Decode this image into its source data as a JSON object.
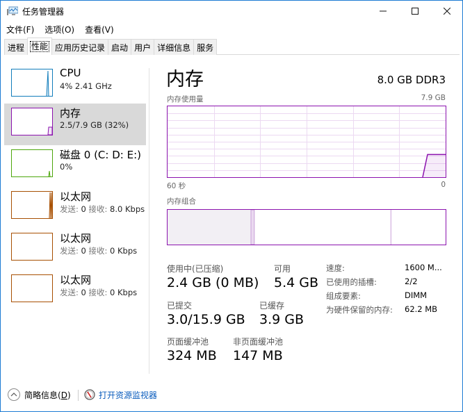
{
  "window": {
    "title": "任务管理器",
    "controls": {
      "minimize": "—",
      "maximize": "☐",
      "close": "✕"
    }
  },
  "menu": [
    "文件(F)",
    "选项(O)",
    "查看(V)"
  ],
  "tabs": [
    {
      "label": "进程",
      "active": false
    },
    {
      "label": "性能",
      "active": true
    },
    {
      "label": "应用历史记录",
      "active": false
    },
    {
      "label": "启动",
      "active": false
    },
    {
      "label": "用户",
      "active": false
    },
    {
      "label": "详细信息",
      "active": false
    },
    {
      "label": "服务",
      "active": false
    }
  ],
  "sidebar": {
    "items": [
      {
        "title": "CPU",
        "subtitle": "4% 2.41 GHz",
        "color": "#117dbb",
        "selected": false
      },
      {
        "title": "内存",
        "subtitle": "2.5/7.9 GB (32%)",
        "color": "#8b12ae",
        "selected": true
      },
      {
        "title": "磁盘 0 (C: D: E:)",
        "subtitle": "0%",
        "color": "#4da60c",
        "selected": false
      },
      {
        "title": "以太网",
        "send_label": "发送:",
        "send": "0",
        "recv_label": "接收:",
        "recv": "8.0 Kbps",
        "color": "#a74f01",
        "selected": false
      },
      {
        "title": "以太网",
        "send_label": "发送:",
        "send": "0",
        "recv_label": "接收:",
        "recv": "0 Kbps",
        "color": "#a74f01",
        "selected": false
      },
      {
        "title": "以太网",
        "send_label": "发送:",
        "send": "0",
        "recv_label": "接收:",
        "recv": "0 Kbps",
        "color": "#a74f01",
        "selected": false
      }
    ]
  },
  "main": {
    "title": "内存",
    "spec": "8.0 GB DDR3",
    "usage_graph": {
      "label": "内存使用量",
      "max_label": "7.9 GB",
      "x_left": "60 秒",
      "x_right": "0",
      "usage_fraction": 0.32,
      "color": "#8b12ae"
    },
    "composition": {
      "label": "内存组合",
      "in_use_fraction": 0.3,
      "modified_fraction": 0.012,
      "standby_fraction": 0.49
    },
    "stats": {
      "in_use_label": "使用中(已压缩)",
      "in_use_value": "2.4 GB (0 MB)",
      "available_label": "可用",
      "available_value": "5.4 GB",
      "committed_label": "已提交",
      "committed_value": "3.0/15.9 GB",
      "cached_label": "已缓存",
      "cached_value": "3.9 GB",
      "paged_label": "页面缓冲池",
      "paged_value": "324 MB",
      "nonpaged_label": "非页面缓冲池",
      "nonpaged_value": "147 MB"
    },
    "details": [
      {
        "label": "速度:",
        "value": "1600 M..."
      },
      {
        "label": "已使用的插槽:",
        "value": "2/2"
      },
      {
        "label": "组成要素:",
        "value": "DIMM"
      },
      {
        "label": "为硬件保留的内存:",
        "value": "62.2 MB"
      }
    ]
  },
  "footer": {
    "fewer_details": "简略信息(",
    "fewer_key": "D",
    "fewer_end": ")",
    "resource_monitor": "打开资源监视器"
  }
}
